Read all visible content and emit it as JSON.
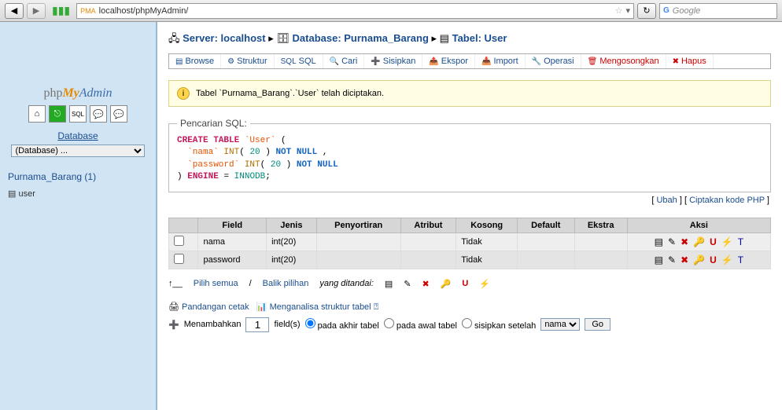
{
  "browser": {
    "url": "localhost/phpMyAdmin/",
    "search_placeholder": "Google"
  },
  "sidebar": {
    "db_label": "Database",
    "db_selected": "(Database) ...",
    "db_link": "Purnama_Barang (1)",
    "table_link": "user"
  },
  "breadcrumb": {
    "server_label": "Server: ",
    "server": "localhost",
    "db_label": "Database: ",
    "db": "Purnama_Barang",
    "table_label": "Tabel: ",
    "table": "User"
  },
  "tabs": [
    "Browse",
    "Struktur",
    "SQL",
    "Cari",
    "Sisipkan",
    "Ekspor",
    "Import",
    "Operasi",
    "Mengosongkan",
    "Hapus"
  ],
  "message": "Tabel `Purnama_Barang`.`User` telah diciptakan.",
  "sql_fieldset_legend": "Pencarian SQL:",
  "sql_lines": {
    "create": "CREATE TABLE",
    "tbl": "`User`",
    "open": "(",
    "f1_name": "`nama`",
    "f1_type": "INT",
    "f1_len": "20",
    "not_null": "NOT NULL",
    "f2_name": "`password`",
    "f2_type": "INT",
    "f2_len": "20",
    "close": ")",
    "engine": "ENGINE",
    "eq": "=",
    "innodb": "INNODB"
  },
  "fieldset_links": {
    "ubah": "Ubah",
    "php": "Ciptakan kode PHP"
  },
  "struct": {
    "headers": [
      "Field",
      "Jenis",
      "Penyortiran",
      "Atribut",
      "Kosong",
      "Default",
      "Ekstra",
      "Aksi"
    ],
    "rows": [
      {
        "field": "nama",
        "jenis": "int(20)",
        "peny": "",
        "attr": "",
        "kosong": "Tidak",
        "def": "",
        "ekstra": ""
      },
      {
        "field": "password",
        "jenis": "int(20)",
        "peny": "",
        "attr": "",
        "kosong": "Tidak",
        "def": "",
        "ekstra": ""
      }
    ],
    "footer": {
      "pilih": "Pilih semua",
      "balik": "Balik pilihan",
      "ditandai": "yang ditandai:"
    }
  },
  "bottom": {
    "print": "Pandangan cetak",
    "analyze": "Menganalisa struktur tabel",
    "add": "Menambahkan",
    "add_count": "1",
    "fields": "field(s)",
    "opt1": "pada akhir tabel",
    "opt2": "pada awal tabel",
    "opt3": "sisipkan setelah",
    "after_field": "nama",
    "go": "Go"
  }
}
